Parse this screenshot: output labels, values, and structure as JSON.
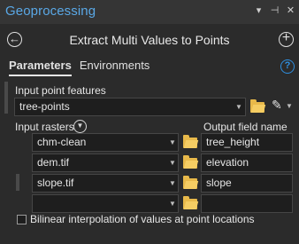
{
  "window": {
    "title": "Geoprocessing",
    "controls": [
      "▾",
      "⊣",
      "✕"
    ]
  },
  "tool": {
    "title": "Extract Multi Values to Points",
    "back_icon": "back-arrow-icon",
    "add_icon": "add-icon"
  },
  "tabs": [
    {
      "label": "Parameters",
      "active": true
    },
    {
      "label": "Environments",
      "active": false
    }
  ],
  "help_label": "?",
  "input_point_features": {
    "label": "Input point features",
    "value": "tree-points"
  },
  "rasters": {
    "label": "Input rasters",
    "output_label": "Output field name",
    "rows": [
      {
        "raster": "chm-clean",
        "field": "tree_height"
      },
      {
        "raster": "dem.tif",
        "field": "elevation"
      },
      {
        "raster": "slope.tif",
        "field": "slope"
      },
      {
        "raster": "",
        "field": ""
      }
    ]
  },
  "bilinear": {
    "label": "Bilinear interpolation of values at point locations",
    "checked": false
  },
  "colors": {
    "accent": "#5aa8e6",
    "folder": "#e8b94a",
    "background": "#2b2b2b"
  }
}
